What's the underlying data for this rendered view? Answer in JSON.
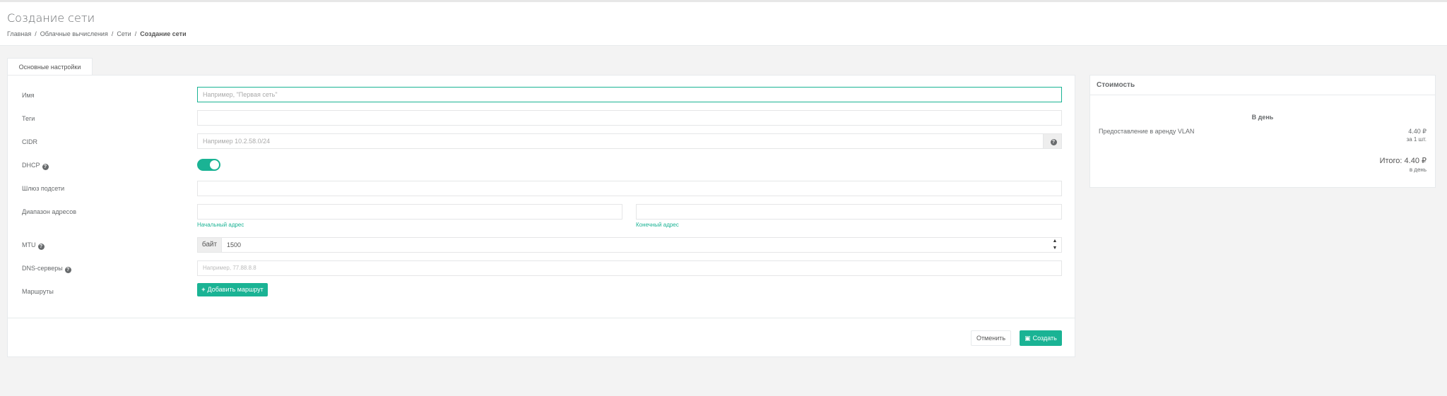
{
  "header": {
    "title": "Создание сети",
    "breadcrumb": [
      "Главная",
      "Облачные вычисления",
      "Сети",
      "Создание сети"
    ]
  },
  "tabs": [
    {
      "label": "Основные настройки",
      "active": true
    }
  ],
  "form": {
    "name": {
      "label": "Имя",
      "value": "",
      "placeholder": "Например, \"Первая сеть\""
    },
    "tags": {
      "label": "Теги",
      "value": ""
    },
    "cidr": {
      "label": "CIDR",
      "value": "",
      "placeholder": "Например 10.2.58.0/24",
      "help_icon": "question-circle-icon"
    },
    "dhcp": {
      "label": "DHCP",
      "enabled": true
    },
    "gateway": {
      "label": "Шлюз подсети",
      "value": ""
    },
    "range": {
      "label": "Диапазон адресов",
      "start_hint": "Начальный адрес",
      "end_hint": "Конечный адрес"
    },
    "mtu": {
      "label": "MTU",
      "unit": "байт",
      "value": "1500"
    },
    "dns": {
      "label": "DNS-серверы",
      "placeholder": "Например, 77.88.8.8"
    },
    "routes": {
      "label": "Маршруты",
      "add_button": "Добавить маршрут"
    }
  },
  "actions": {
    "cancel": "Отменить",
    "create": "Создать"
  },
  "cost": {
    "title": "Стоимость",
    "period": "В день",
    "item_name": "Предоставление в аренду VLAN",
    "item_price": "4.40 ₽",
    "item_qty": "за 1 шт.",
    "total": "Итого: 4.40 ₽",
    "total_period": "в день"
  },
  "colors": {
    "accent": "#1ab394",
    "background": "#f3f3f3"
  }
}
